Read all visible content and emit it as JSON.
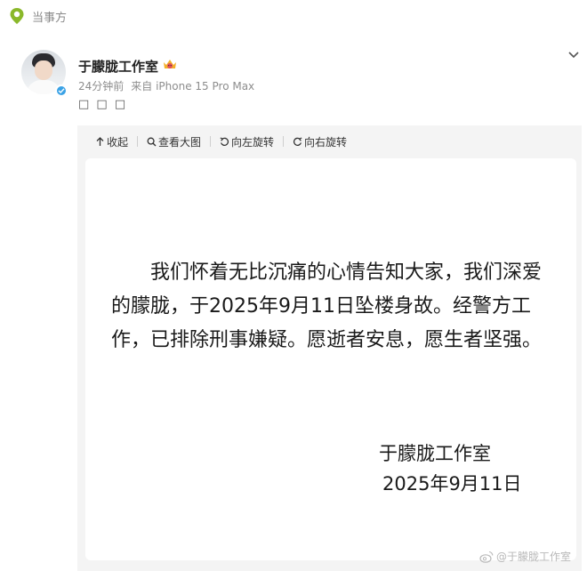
{
  "topbar": {
    "label": "当事方",
    "icon": "location-pin-icon",
    "icon_color": "#8ab82a"
  },
  "post": {
    "username": "于朦胧工作室",
    "badge_icon": "crown-emoji-icon",
    "time": "24分钟前",
    "source": "来自 iPhone 15 Pro Max",
    "text": "□ □ □",
    "verified_color": "#3aa2e6"
  },
  "toolbar": {
    "collapse": "收起",
    "view_large": "查看大图",
    "rotate_left": "向左旋转",
    "rotate_right": "向右旋转"
  },
  "statement": {
    "body": "我们怀着无比沉痛的心情告知大家，我们深爱的朦胧，于2025年9月11日坠楼身故。经警方工作，已排除刑事嫌疑。愿逝者安息，愿生者坚强。",
    "signature": "于朦胧工作室",
    "date": "2025年9月11日"
  },
  "watermark": "@于朦胧工作室"
}
